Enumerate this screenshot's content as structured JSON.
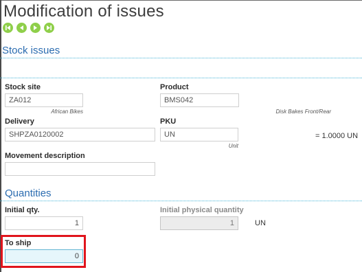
{
  "page": {
    "title": "Modification of issues"
  },
  "nav": {
    "icons": [
      "first-icon",
      "previous-icon",
      "next-icon",
      "last-icon"
    ],
    "color": "#8fcf4a"
  },
  "stock_issues": {
    "section_title": "Stock issues",
    "stock_site": {
      "label": "Stock site",
      "value": "ZA012",
      "hint": "African Bikes"
    },
    "product": {
      "label": "Product",
      "value": "BMS042",
      "hint": "Disk Bakes Front/Rear"
    },
    "delivery": {
      "label": "Delivery",
      "value": "SHPZA0120002"
    },
    "pku": {
      "label": "PKU",
      "value": "UN",
      "hint": "Unit",
      "conversion": "= 1.0000 UN"
    },
    "movement_description": {
      "label": "Movement description",
      "value": ""
    }
  },
  "quantities": {
    "section_title": "Quantities",
    "initial_qty": {
      "label": "Initial qty.",
      "value": "1"
    },
    "initial_physical_quantity": {
      "label": "Initial physical quantity",
      "value": "1",
      "unit": "UN"
    },
    "to_ship": {
      "label": "To ship",
      "value": "0"
    }
  },
  "colors": {
    "accent": "#2b6cb0",
    "separator": "#46b5d8",
    "highlight": "#e0141c"
  }
}
